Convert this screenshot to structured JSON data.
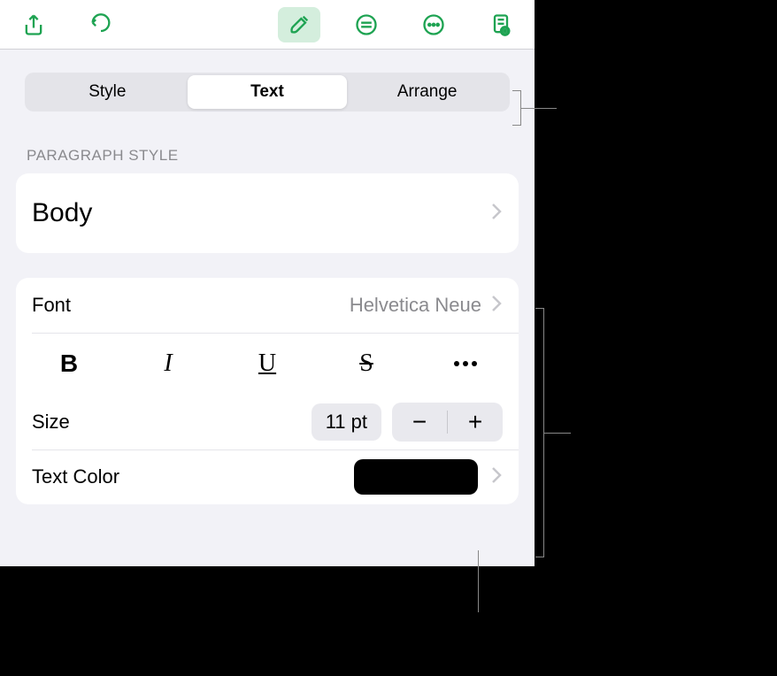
{
  "toolbar": {
    "share_icon": "share-icon",
    "undo_icon": "undo-icon",
    "format_icon": "paintbrush-icon",
    "insert_icon": "insert-icon",
    "more_icon": "more-icon",
    "document_icon": "document-icon"
  },
  "tabs": {
    "style": "Style",
    "text": "Text",
    "arrange": "Arrange",
    "active": "Text"
  },
  "paragraph_style": {
    "header": "Paragraph Style",
    "value": "Body"
  },
  "font": {
    "label": "Font",
    "value": "Helvetica Neue"
  },
  "style_buttons": {
    "bold": "B",
    "italic": "I",
    "underline": "U",
    "strike": "S"
  },
  "size": {
    "label": "Size",
    "value": "11 pt",
    "minus": "−",
    "plus": "+"
  },
  "text_color": {
    "label": "Text Color",
    "swatch": "#000000"
  }
}
